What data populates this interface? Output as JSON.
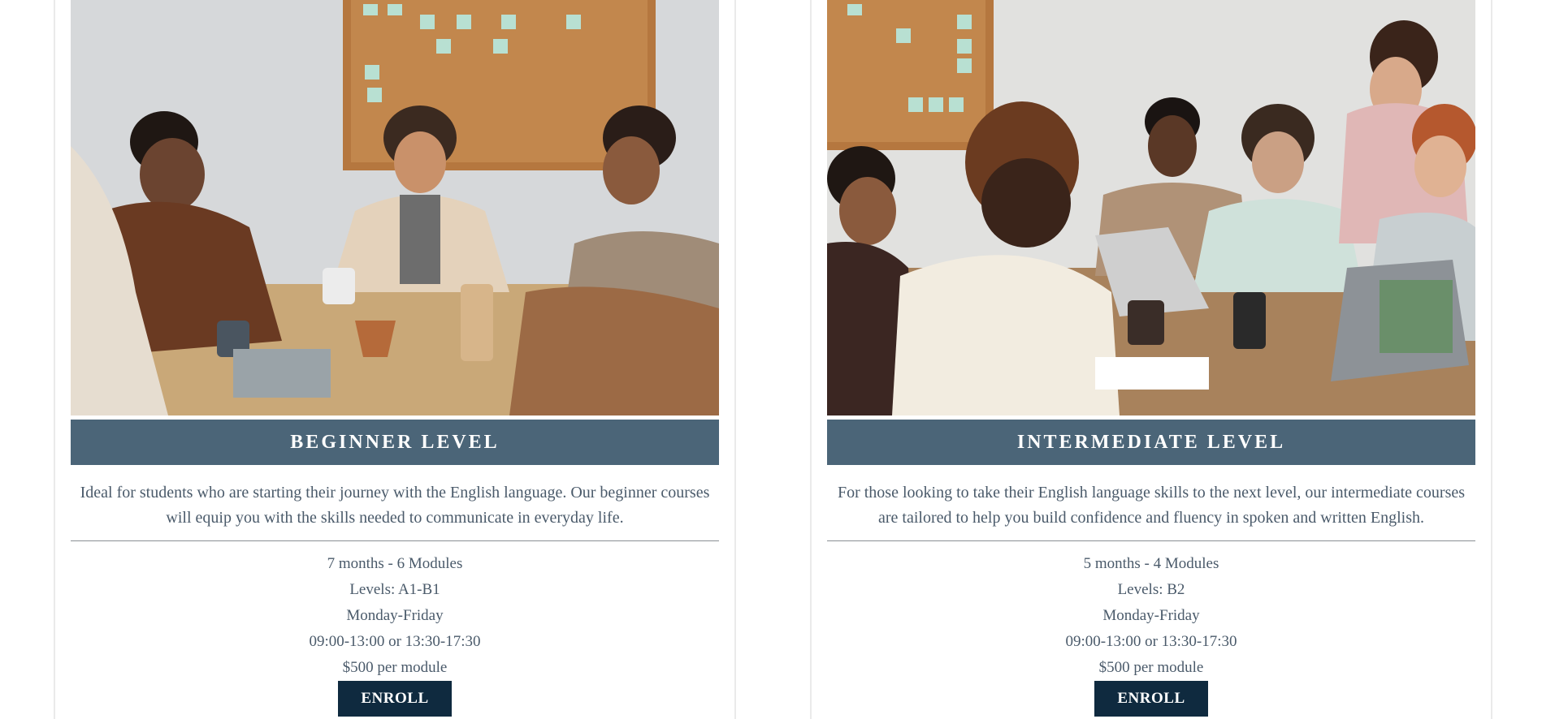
{
  "courses": [
    {
      "title": "BEGINNER LEVEL",
      "description": "Ideal for students who are starting their journey with the English language. Our beginner courses will equip you with the skills needed to communicate in everyday life.",
      "duration": "7 months - 6 Modules",
      "levels": "Levels: A1-B1",
      "days": "Monday-Friday",
      "hours": "09:00-13:00 or 13:30-17:30",
      "price": "$500 per module",
      "button": "ENROLL"
    },
    {
      "title": "INTERMEDIATE LEVEL",
      "description": "For those looking to take their English language skills to the next level, our intermediate courses are tailored to help you build confidence and fluency in spoken and written English.",
      "duration": "5 months - 4 Modules",
      "levels": "Levels: B2",
      "days": "Monday-Friday",
      "hours": "09:00-13:00 or 13:30-17:30",
      "price": "$500 per module",
      "button": "ENROLL"
    }
  ],
  "colors": {
    "banner": "#4b6578",
    "button": "#0f2a3f",
    "text": "#4a5a6a"
  }
}
